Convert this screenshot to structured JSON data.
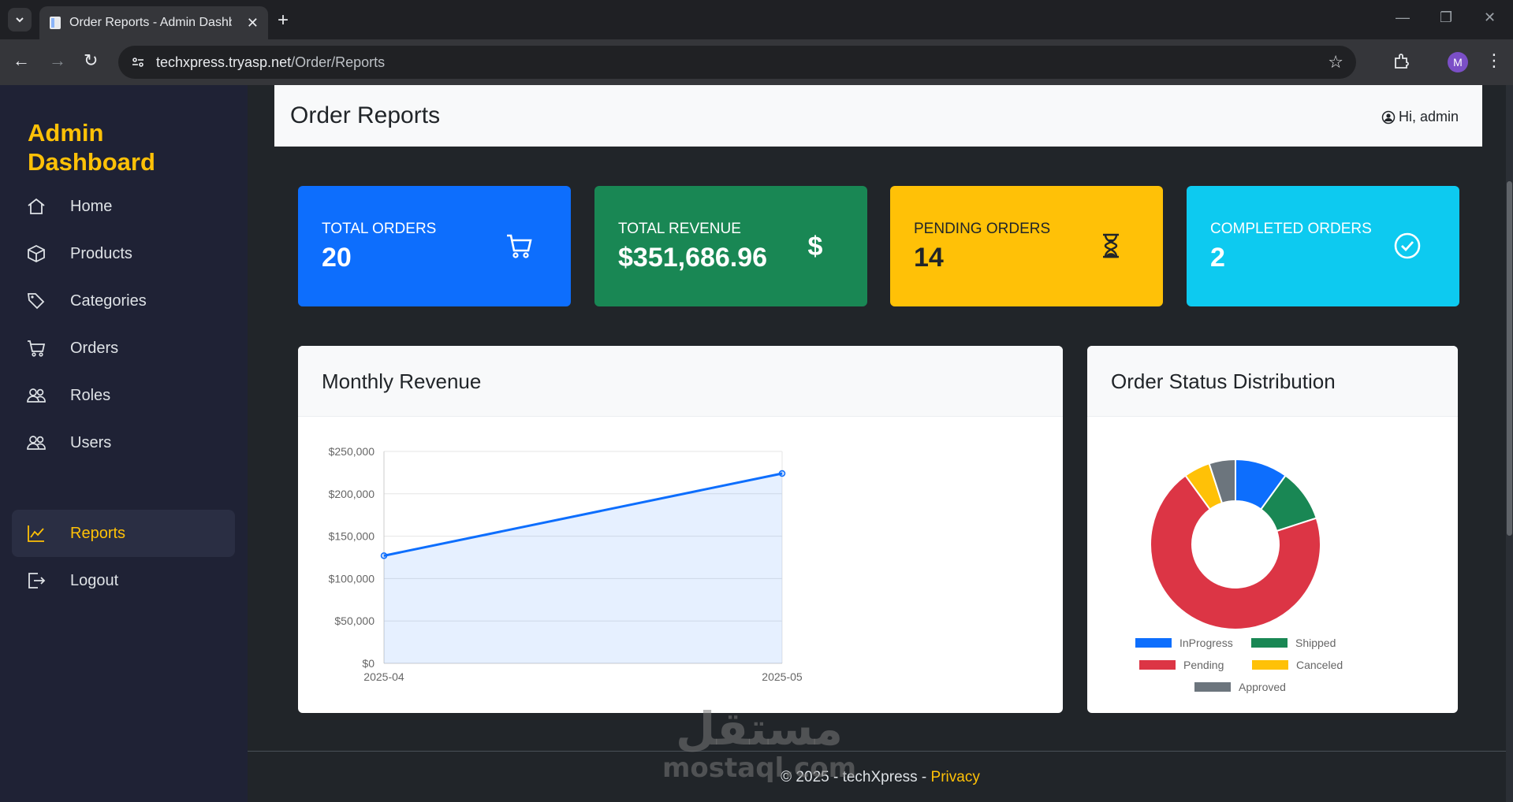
{
  "browser": {
    "tab_title": "Order Reports - Admin Dashboard",
    "url_host": "techxpress.tryasp.net",
    "url_path": "/Order/Reports",
    "profile_initial": "M"
  },
  "sidebar": {
    "brand": "Admin Dashboard",
    "items": [
      {
        "label": "Home",
        "icon": "home-icon"
      },
      {
        "label": "Products",
        "icon": "box-icon"
      },
      {
        "label": "Categories",
        "icon": "tags-icon"
      },
      {
        "label": "Orders",
        "icon": "cart-icon"
      },
      {
        "label": "Roles",
        "icon": "people-icon"
      },
      {
        "label": "Users",
        "icon": "people-icon"
      },
      {
        "label": "Reports",
        "icon": "graph-icon",
        "active": true
      },
      {
        "label": "Logout",
        "icon": "logout-icon"
      }
    ]
  },
  "header": {
    "title": "Order Reports",
    "greeting": "Hi, admin"
  },
  "stats": [
    {
      "label": "TOTAL ORDERS",
      "value": "20",
      "icon": "cart-icon",
      "color": "#0d6efd",
      "text_color": "#ffffff"
    },
    {
      "label": "TOTAL REVENUE",
      "value": "$351,686.96",
      "icon": "dollar-icon",
      "color": "#198754",
      "text_color": "#ffffff"
    },
    {
      "label": "PENDING ORDERS",
      "value": "14",
      "icon": "hourglass-icon",
      "color": "#ffc107",
      "text_color": "#212529"
    },
    {
      "label": "COMPLETED ORDERS",
      "value": "2",
      "icon": "check-circle-icon",
      "color": "#0dcaf0",
      "text_color": "#ffffff"
    }
  ],
  "revenue_card": {
    "title": "Monthly Revenue"
  },
  "status_card": {
    "title": "Order Status Distribution"
  },
  "chart_data": [
    {
      "type": "area",
      "title": "",
      "x": [
        "2025-04",
        "2025-05"
      ],
      "values": [
        127000,
        224000
      ],
      "ylim": [
        0,
        250000
      ],
      "yticks": [
        "$0",
        "$50,000",
        "$100,000",
        "$150,000",
        "$200,000",
        "$250,000"
      ],
      "color": "#0d6efd",
      "grid": true
    },
    {
      "type": "pie",
      "title": "",
      "categories": [
        "InProgress",
        "Shipped",
        "Pending",
        "Canceled",
        "Approved"
      ],
      "values": [
        2,
        2,
        14,
        1,
        1
      ],
      "colors": [
        "#0d6efd",
        "#198754",
        "#dc3545",
        "#ffc107",
        "#6c757d"
      ],
      "legend": "bottom"
    }
  ],
  "footer": {
    "text": "© 2025 - techXpress - ",
    "link": "Privacy"
  },
  "watermark": {
    "arabic": "مستقل",
    "latin": "mostaql.com"
  }
}
